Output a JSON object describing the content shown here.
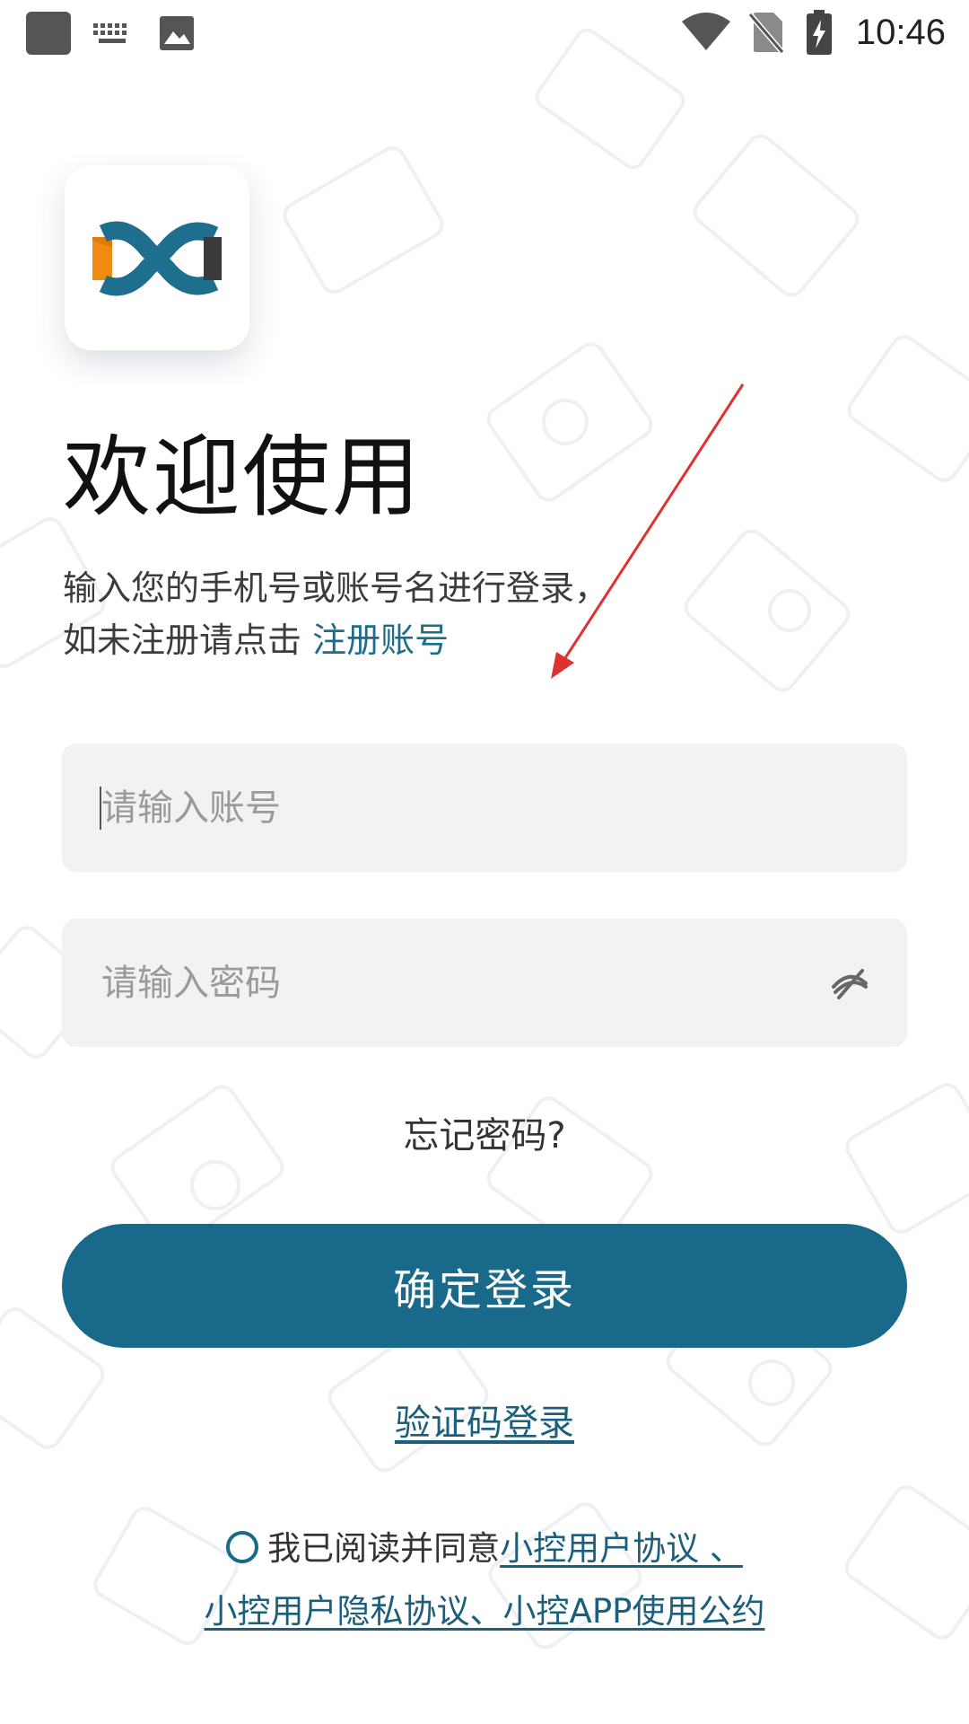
{
  "status_bar": {
    "time": "10:46",
    "left_icons": [
      "app-square-icon",
      "keyboard-icon",
      "image-icon"
    ],
    "right_icons": [
      "wifi-icon",
      "no-sim-icon",
      "battery-charging-icon"
    ]
  },
  "welcome": {
    "title": "欢迎使用",
    "subtitle_line1": "输入您的手机号或账号名进行登录，",
    "subtitle_line2_prefix": "如未注册请点击 ",
    "register_link": "注册账号"
  },
  "form": {
    "account_placeholder": "请输入账号",
    "password_placeholder": "请输入密码",
    "password_toggle_icon": "eye-off-icon",
    "forgot_password": "忘记密码?",
    "login_button": "确定登录",
    "sms_login": "验证码登录"
  },
  "agreement": {
    "prefix": "我已阅读并同意",
    "link_user_agreement": "小控用户协议 、",
    "link_privacy": "小控用户隐私协议、",
    "link_app_convention": "小控APP使用公约"
  },
  "colors": {
    "primary": "#196a8a",
    "link": "#1c6d8c",
    "field_bg": "#f2f2f2",
    "logo_orange": "#f08a10",
    "logo_teal": "#1e6e8e",
    "logo_dark": "#3a3a3a",
    "annotation_arrow": "#e03030"
  }
}
